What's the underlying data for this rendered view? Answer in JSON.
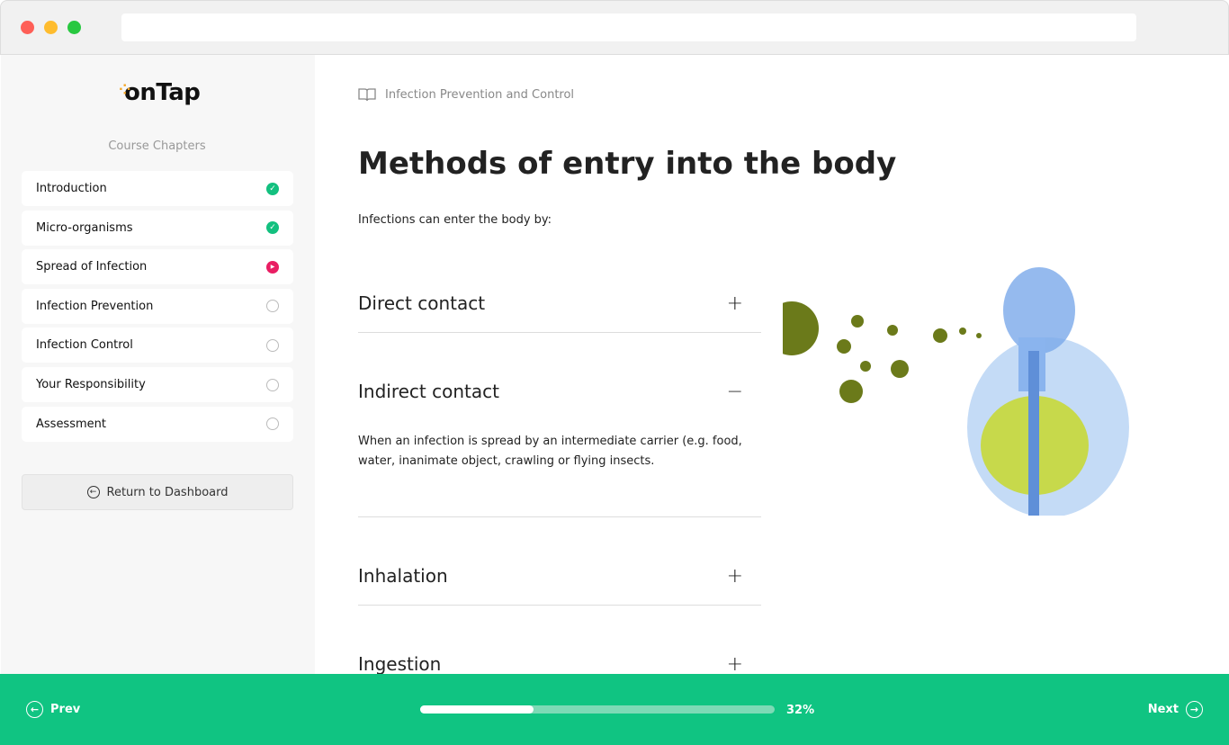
{
  "brand": {
    "logo": "onTap"
  },
  "sidebar": {
    "heading": "Course Chapters",
    "chapters": [
      {
        "label": "Introduction",
        "status": "complete"
      },
      {
        "label": "Micro-organisms",
        "status": "complete"
      },
      {
        "label": "Spread of Infection",
        "status": "current"
      },
      {
        "label": "Infection Prevention",
        "status": "incomplete"
      },
      {
        "label": "Infection Control",
        "status": "incomplete"
      },
      {
        "label": "Your Responsibility",
        "status": "incomplete"
      },
      {
        "label": "Assessment",
        "status": "incomplete"
      }
    ],
    "return_label": "Return to Dashboard"
  },
  "main": {
    "breadcrumb": "Infection Prevention and Control",
    "title": "Methods of entry into the body",
    "intro": "Infections can enter the body by:",
    "accordion": [
      {
        "title": "Direct contact",
        "expanded": false,
        "icon": "+"
      },
      {
        "title": "Indirect contact",
        "expanded": true,
        "icon": "−",
        "body": "When an infection is spread by an intermediate carrier (e.g. food, water, inanimate object, crawling or flying insects."
      },
      {
        "title": "Inhalation",
        "expanded": false,
        "icon": "+"
      },
      {
        "title": "Ingestion",
        "expanded": false,
        "icon": "+"
      }
    ]
  },
  "footer": {
    "prev": "Prev",
    "next": "Next",
    "progress": 32,
    "progress_label": "32%"
  },
  "colors": {
    "accent": "#10c482",
    "current": "#e91e63"
  }
}
